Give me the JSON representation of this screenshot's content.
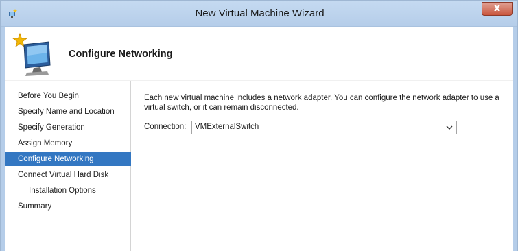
{
  "window": {
    "title": "New Virtual Machine Wizard",
    "close_label": "x"
  },
  "header": {
    "title": "Configure Networking",
    "icon": "computer-sparkle-icon"
  },
  "sidebar": {
    "items": [
      {
        "label": "Before You Begin",
        "active": false,
        "sub": false
      },
      {
        "label": "Specify Name and Location",
        "active": false,
        "sub": false
      },
      {
        "label": "Specify Generation",
        "active": false,
        "sub": false
      },
      {
        "label": "Assign Memory",
        "active": false,
        "sub": false
      },
      {
        "label": "Configure Networking",
        "active": true,
        "sub": false
      },
      {
        "label": "Connect Virtual Hard Disk",
        "active": false,
        "sub": false
      },
      {
        "label": "Installation Options",
        "active": false,
        "sub": true
      },
      {
        "label": "Summary",
        "active": false,
        "sub": false
      }
    ]
  },
  "main": {
    "description": "Each new virtual machine includes a network adapter. You can configure the network adapter to use a virtual switch, or it can remain disconnected.",
    "connection_label": "Connection:",
    "connection_value": "VMExternalSwitch"
  },
  "colors": {
    "accent": "#3377c2",
    "titlebar": "#c5daf1",
    "close": "#c9553d"
  }
}
